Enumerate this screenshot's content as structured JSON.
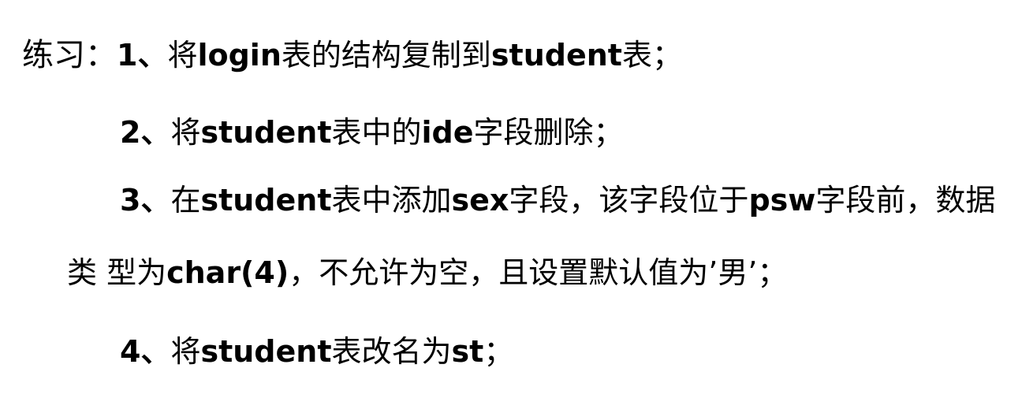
{
  "exercise": {
    "label": "练习：",
    "items": [
      {
        "num": "1、",
        "parts": [
          "将",
          "login",
          "表的结构复制到",
          "student",
          "表；"
        ]
      },
      {
        "num": "2、",
        "parts": [
          "将",
          "student",
          "表中的",
          "ide",
          "字段删除；"
        ]
      },
      {
        "num": "3、",
        "parts": [
          "在",
          "student",
          "表中添加",
          "sex",
          "字段，该字段位于",
          "psw",
          "字段前，数据"
        ],
        "continuation": [
          "类 型为",
          "char(4)",
          "，不允许为空，且设置默认值为’男’；"
        ]
      },
      {
        "num": "4、",
        "parts": [
          "将",
          "student",
          "表改名为",
          "st",
          "；"
        ]
      }
    ]
  }
}
